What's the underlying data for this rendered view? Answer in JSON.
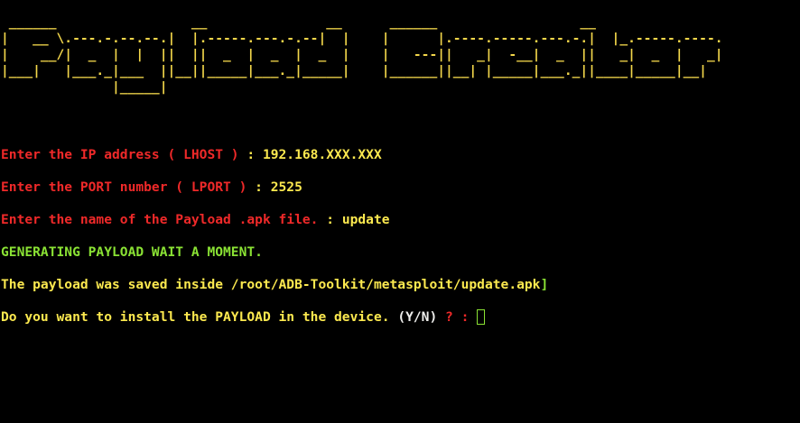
{
  "banner": {
    "ascii_art": " ______                 __               __      ______                  __\n|   __ \\.---.-.--.--.|  |.-----.---.-.--|  |    |      |.----.-----.---.-.|  |_.-----.----.\n|    __/|  _  |  |  ||  ||  _  |  _  |  _  |    |   ---||   _|  -__|  _  ||   _|  _  |   _|\n|___|   |___._|___  ||__||_____|___._|_____|    |______||__| |_____|___._||____|_____|__|\n              |_____|",
    "text": "Payload Creator"
  },
  "prompts": {
    "lhost": {
      "label": "Enter the IP address ( LHOST )",
      "separator": " : ",
      "value": "192.168.XXX.XXX"
    },
    "lport": {
      "label": "Enter the PORT number ( LPORT )",
      "separator": " : ",
      "value": "2525"
    },
    "apk_name": {
      "label": "Enter the name of the Payload .apk file.",
      "separator": " : ",
      "value": "update"
    }
  },
  "status": {
    "generating": "GENERATING PAYLOAD WAIT A MOMENT.",
    "saved": "The payload was saved inside /root/ADB-Toolkit/metasploit/update.apk",
    "saved_bracket": "]"
  },
  "install_prompt": {
    "question": "Do you want to install the PAYLOAD in the device.",
    "options": " (Y/N)",
    "qmark": " ? :",
    "input_value": ""
  },
  "colors": {
    "background": "#000000",
    "label": "#ef2929",
    "value": "#fce94f",
    "status": "#8ae234",
    "banner": "#f2d64a"
  }
}
